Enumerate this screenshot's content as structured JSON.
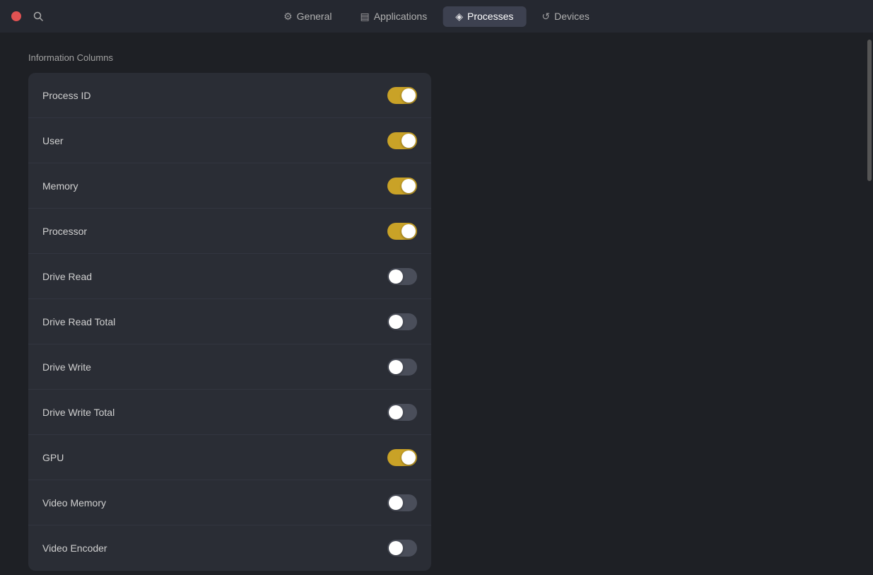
{
  "titlebar": {
    "tabs": [
      {
        "id": "general",
        "label": "General",
        "icon": "⚙",
        "active": false
      },
      {
        "id": "applications",
        "label": "Applications",
        "icon": "▤",
        "active": false
      },
      {
        "id": "processes",
        "label": "Processes",
        "icon": "◈",
        "active": true
      },
      {
        "id": "devices",
        "label": "Devices",
        "icon": "↺",
        "active": false
      }
    ]
  },
  "section": {
    "title": "Information Columns",
    "rows": [
      {
        "id": "process-id",
        "label": "Process ID",
        "enabled": true
      },
      {
        "id": "user",
        "label": "User",
        "enabled": true
      },
      {
        "id": "memory",
        "label": "Memory",
        "enabled": true
      },
      {
        "id": "processor",
        "label": "Processor",
        "enabled": true
      },
      {
        "id": "drive-read",
        "label": "Drive Read",
        "enabled": false
      },
      {
        "id": "drive-read-total",
        "label": "Drive Read Total",
        "enabled": false
      },
      {
        "id": "drive-write",
        "label": "Drive Write",
        "enabled": false
      },
      {
        "id": "drive-write-total",
        "label": "Drive Write Total",
        "enabled": false
      },
      {
        "id": "gpu",
        "label": "GPU",
        "enabled": true
      },
      {
        "id": "video-memory",
        "label": "Video Memory",
        "enabled": false
      },
      {
        "id": "video-encoder",
        "label": "Video Encoder",
        "enabled": false
      }
    ]
  }
}
